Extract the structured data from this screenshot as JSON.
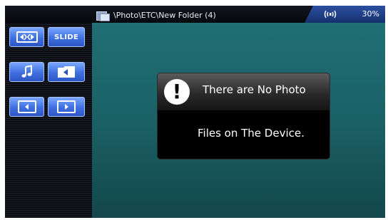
{
  "topbar": {
    "folder_icon": "folder-icon",
    "path": "\\Photo\\ETC\\New Folder (4)",
    "wifi_icon": "wifi-signal-icon",
    "battery": "30%"
  },
  "sidebar": {
    "buttons": [
      {
        "name": "fullscreen-button",
        "icon": "fullscreen-arrows-icon"
      },
      {
        "name": "slide-button",
        "label": "SLIDE"
      },
      {
        "name": "music-button",
        "icon": "music-note-icon"
      },
      {
        "name": "folder-back-button",
        "icon": "folder-arrow-icon"
      },
      {
        "name": "previous-button",
        "icon": "arrow-left-icon"
      },
      {
        "name": "next-button",
        "icon": "arrow-right-icon"
      }
    ]
  },
  "dialog": {
    "icon": "alert-exclamation-icon",
    "line1": "There are No Photo",
    "line2": "Files on The Device."
  },
  "colors": {
    "accent": "#3f6fe0",
    "main_bg": "#1a6166",
    "status_bg": "#2b4fa0"
  }
}
